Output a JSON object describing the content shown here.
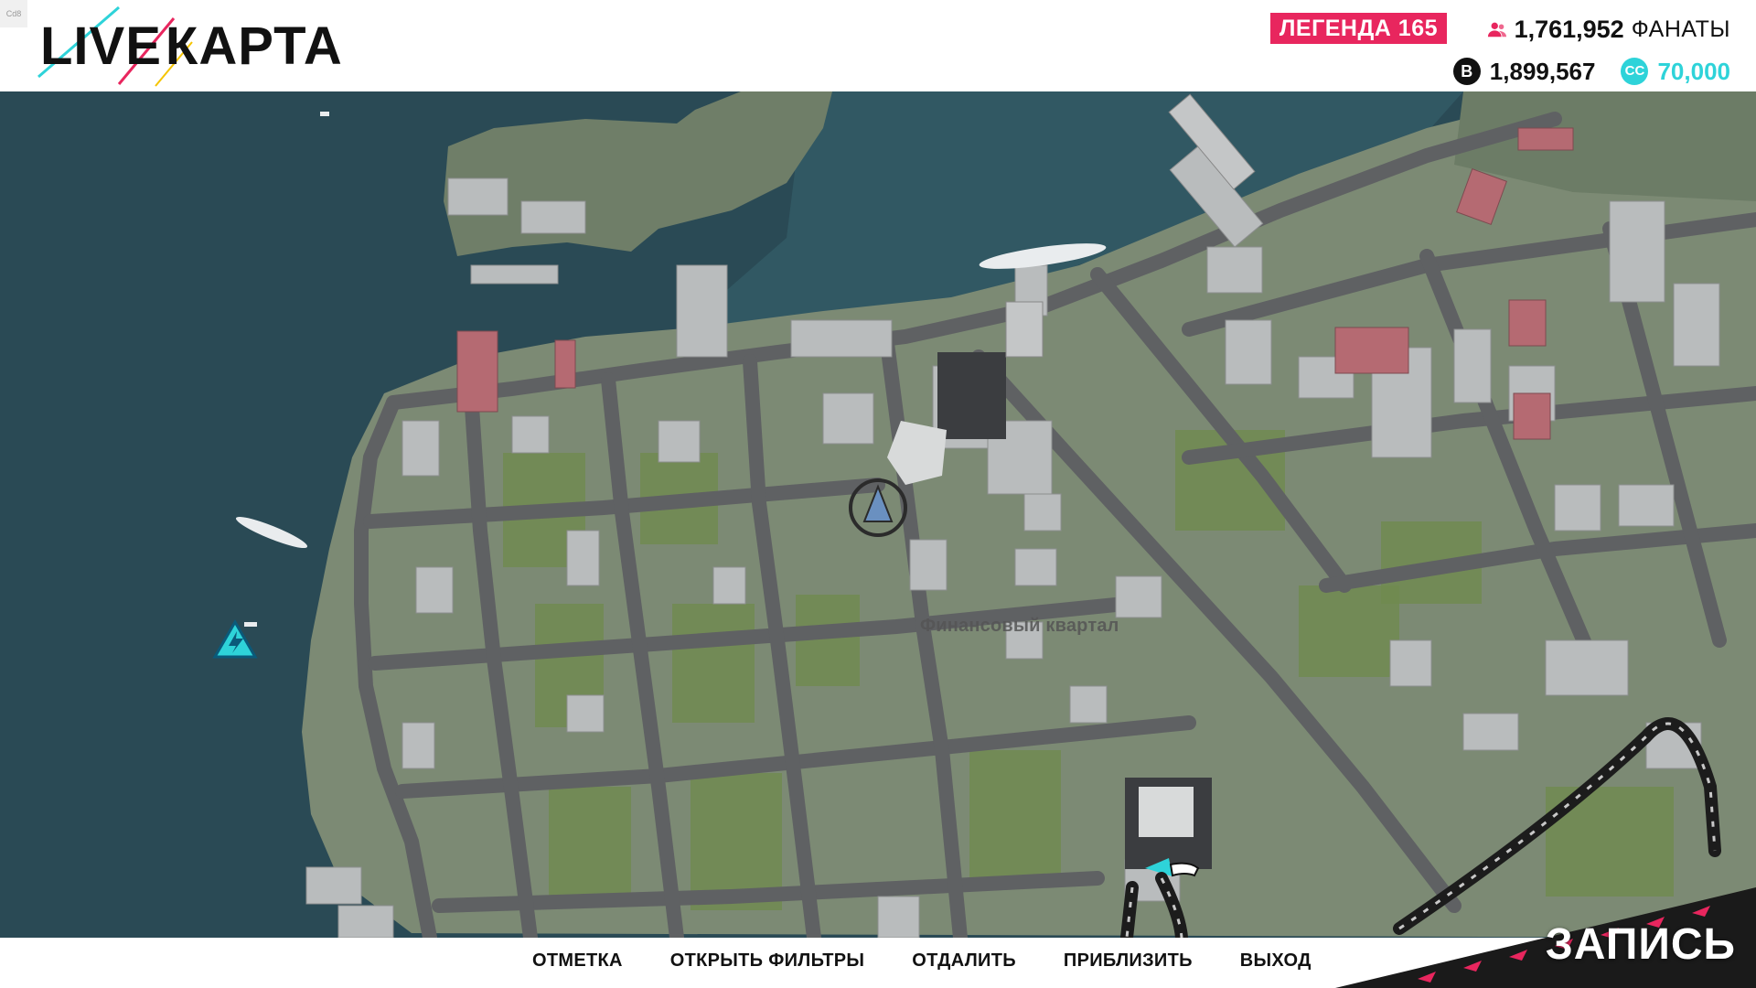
{
  "build_tag": "Cd8",
  "header": {
    "logo_part1": "LIVE",
    "logo_part2": "КАРТА",
    "legend_badge": "ЛЕГЕНДА 165",
    "fans_count": "1,761,952",
    "fans_label": "ФАНАТЫ",
    "credits": "1,899,567",
    "credit_icon_label": "B",
    "cc_icon_label": "CC",
    "cc_amount": "70,000"
  },
  "map": {
    "district_label": "Финансовый квартал",
    "markers": [
      {
        "name": "building-marker-icon",
        "kind": "current-objective"
      },
      {
        "name": "speed-trap-icon",
        "kind": "event"
      },
      {
        "name": "player-car-icon",
        "kind": "player"
      }
    ]
  },
  "recording_label": "ЗАПИСЬ",
  "footer": {
    "actions": [
      {
        "id": "mark",
        "label": "ОТМЕТКА"
      },
      {
        "id": "filters",
        "label": "ОТКРЫТЬ ФИЛЬТРЫ"
      },
      {
        "id": "zoom-out",
        "label": "ОТДАЛИТЬ"
      },
      {
        "id": "zoom-in",
        "label": "ПРИБЛИЗИТЬ"
      },
      {
        "id": "exit",
        "label": "ВЫХОД"
      }
    ]
  },
  "colors": {
    "legend_badge": "#e8265e",
    "cc_accent": "#2ed3d9",
    "water": "#2a4a55",
    "land": "#7c8a74",
    "road": "#5f6163",
    "building": "#b9bcbd"
  }
}
